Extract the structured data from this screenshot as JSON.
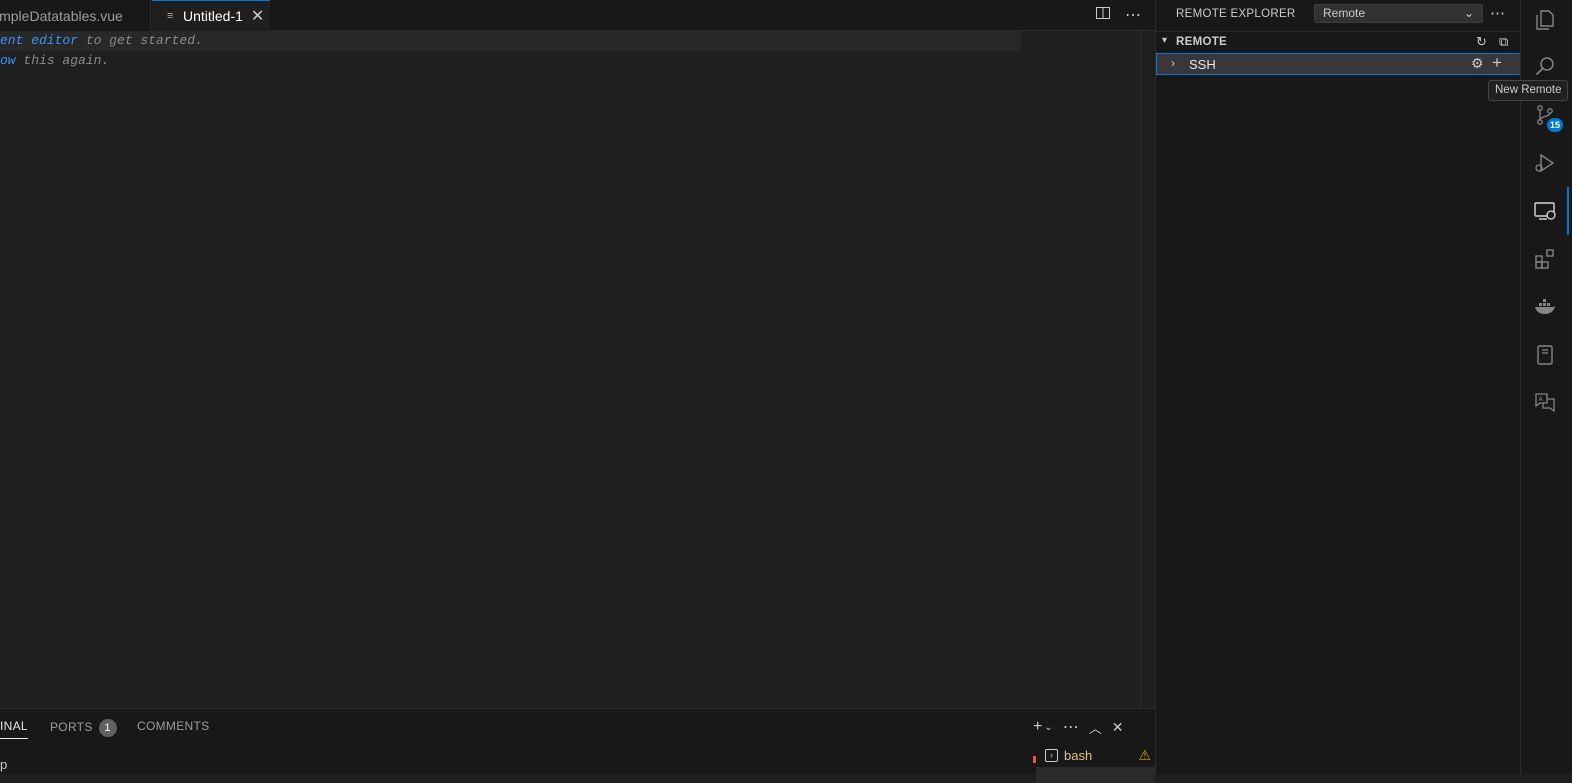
{
  "tabs": [
    {
      "label": "impleDatatables.vue",
      "active": false
    },
    {
      "label": "Untitled-1",
      "active": true,
      "close_glyph": "✕"
    }
  ],
  "editor": {
    "line1": {
      "link": "ent editor",
      "text": " to get started."
    },
    "line2": {
      "link": "ow",
      "text": " this again."
    }
  },
  "panel": {
    "tabs": [
      {
        "label": "INAL",
        "active": true
      },
      {
        "label": "PORTS",
        "badge": "1"
      },
      {
        "label": "COMMENTS"
      }
    ],
    "terminal": {
      "name": "bash",
      "prompt": "p"
    }
  },
  "sidebar": {
    "title": "REMOTE EXPLORER",
    "select_value": "Remote",
    "section": "REMOTE",
    "tree_item": "SSH"
  },
  "tooltip": "New Remote",
  "activity": {
    "items": [
      "explorer-icon",
      "search-icon",
      "source-control-icon",
      "run-debug-icon",
      "remote-explorer-icon",
      "extensions-icon",
      "docker-icon",
      "notebook-icon",
      "translate-icon"
    ],
    "source_control_badge": "15"
  },
  "colors": {
    "accent": "#0078d4",
    "link": "#3794ff",
    "warning": "#cca700"
  }
}
